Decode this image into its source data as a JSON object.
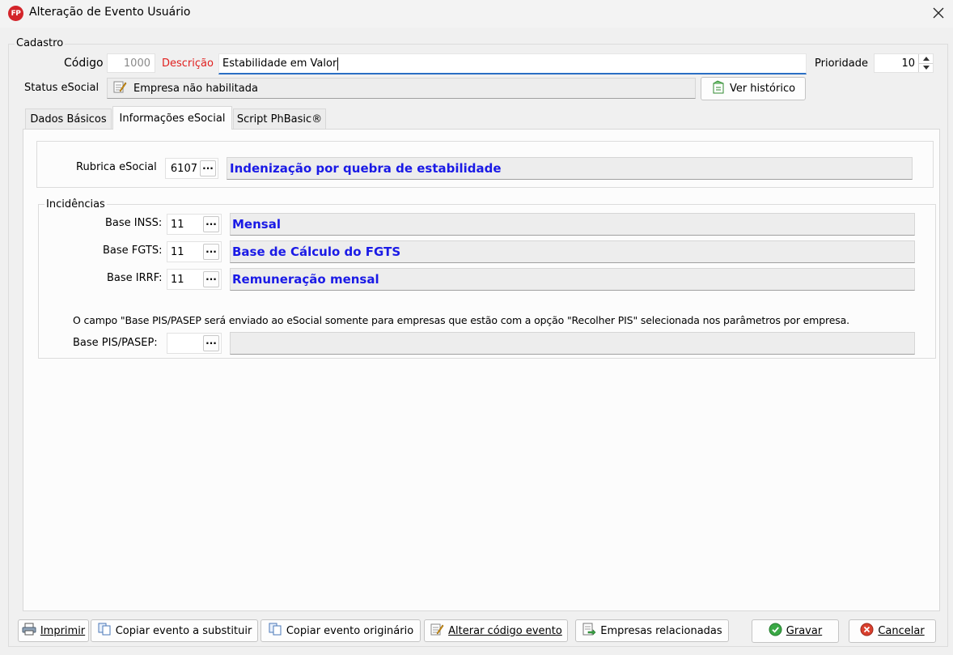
{
  "window": {
    "title": "Alteração de Evento Usuário",
    "app_icon_text": "FP"
  },
  "cadastro": {
    "legend": "Cadastro",
    "codigo_label": "Código",
    "codigo_value": "1000",
    "descricao_label": "Descrição",
    "descricao_value": "Estabilidade em Valor",
    "prioridade_label": "Prioridade",
    "prioridade_value": "10",
    "status_label": "Status eSocial",
    "status_value": "Empresa não habilitada",
    "ver_historico": "Ver histórico"
  },
  "tabs": [
    {
      "label": "Dados Básicos"
    },
    {
      "label": "Informações eSocial"
    },
    {
      "label": "Script PhBasic®"
    }
  ],
  "esocial": {
    "rubrica_label": "Rubrica eSocial",
    "rubrica_code": "6107",
    "rubrica_desc": "Indenização por quebra de estabilidade"
  },
  "incidencias": {
    "legend": "Incidências",
    "rows": [
      {
        "label": "Base INSS:",
        "code": "11",
        "desc": "Mensal"
      },
      {
        "label": "Base FGTS:",
        "code": "11",
        "desc": "Base de Cálculo do FGTS"
      },
      {
        "label": "Base IRRF:",
        "code": "11",
        "desc": "Remuneração mensal"
      }
    ],
    "note": "O campo \"Base PIS/PASEP será enviado ao eSocial somente para empresas que estão com a opção \"Recolher PIS\" selecionada nos parâmetros por empresa.",
    "pis_label": "Base PIS/PASEP:",
    "pis_code": "",
    "pis_desc": ""
  },
  "footer": {
    "imprimir": "Imprimir",
    "copiar_substituir": "Copiar evento a substituir",
    "copiar_originario": "Copiar evento originário",
    "alterar_codigo": "Alterar código evento",
    "empresas": "Empresas relacionadas",
    "gravar": "Gravar",
    "cancelar": "Cancelar"
  },
  "ellipsis": "···",
  "colors": {
    "accent_blue": "#1a1ae6",
    "label_red": "#e0201f",
    "gravar_green": "#3aa845",
    "cancel_red": "#d9402e"
  }
}
